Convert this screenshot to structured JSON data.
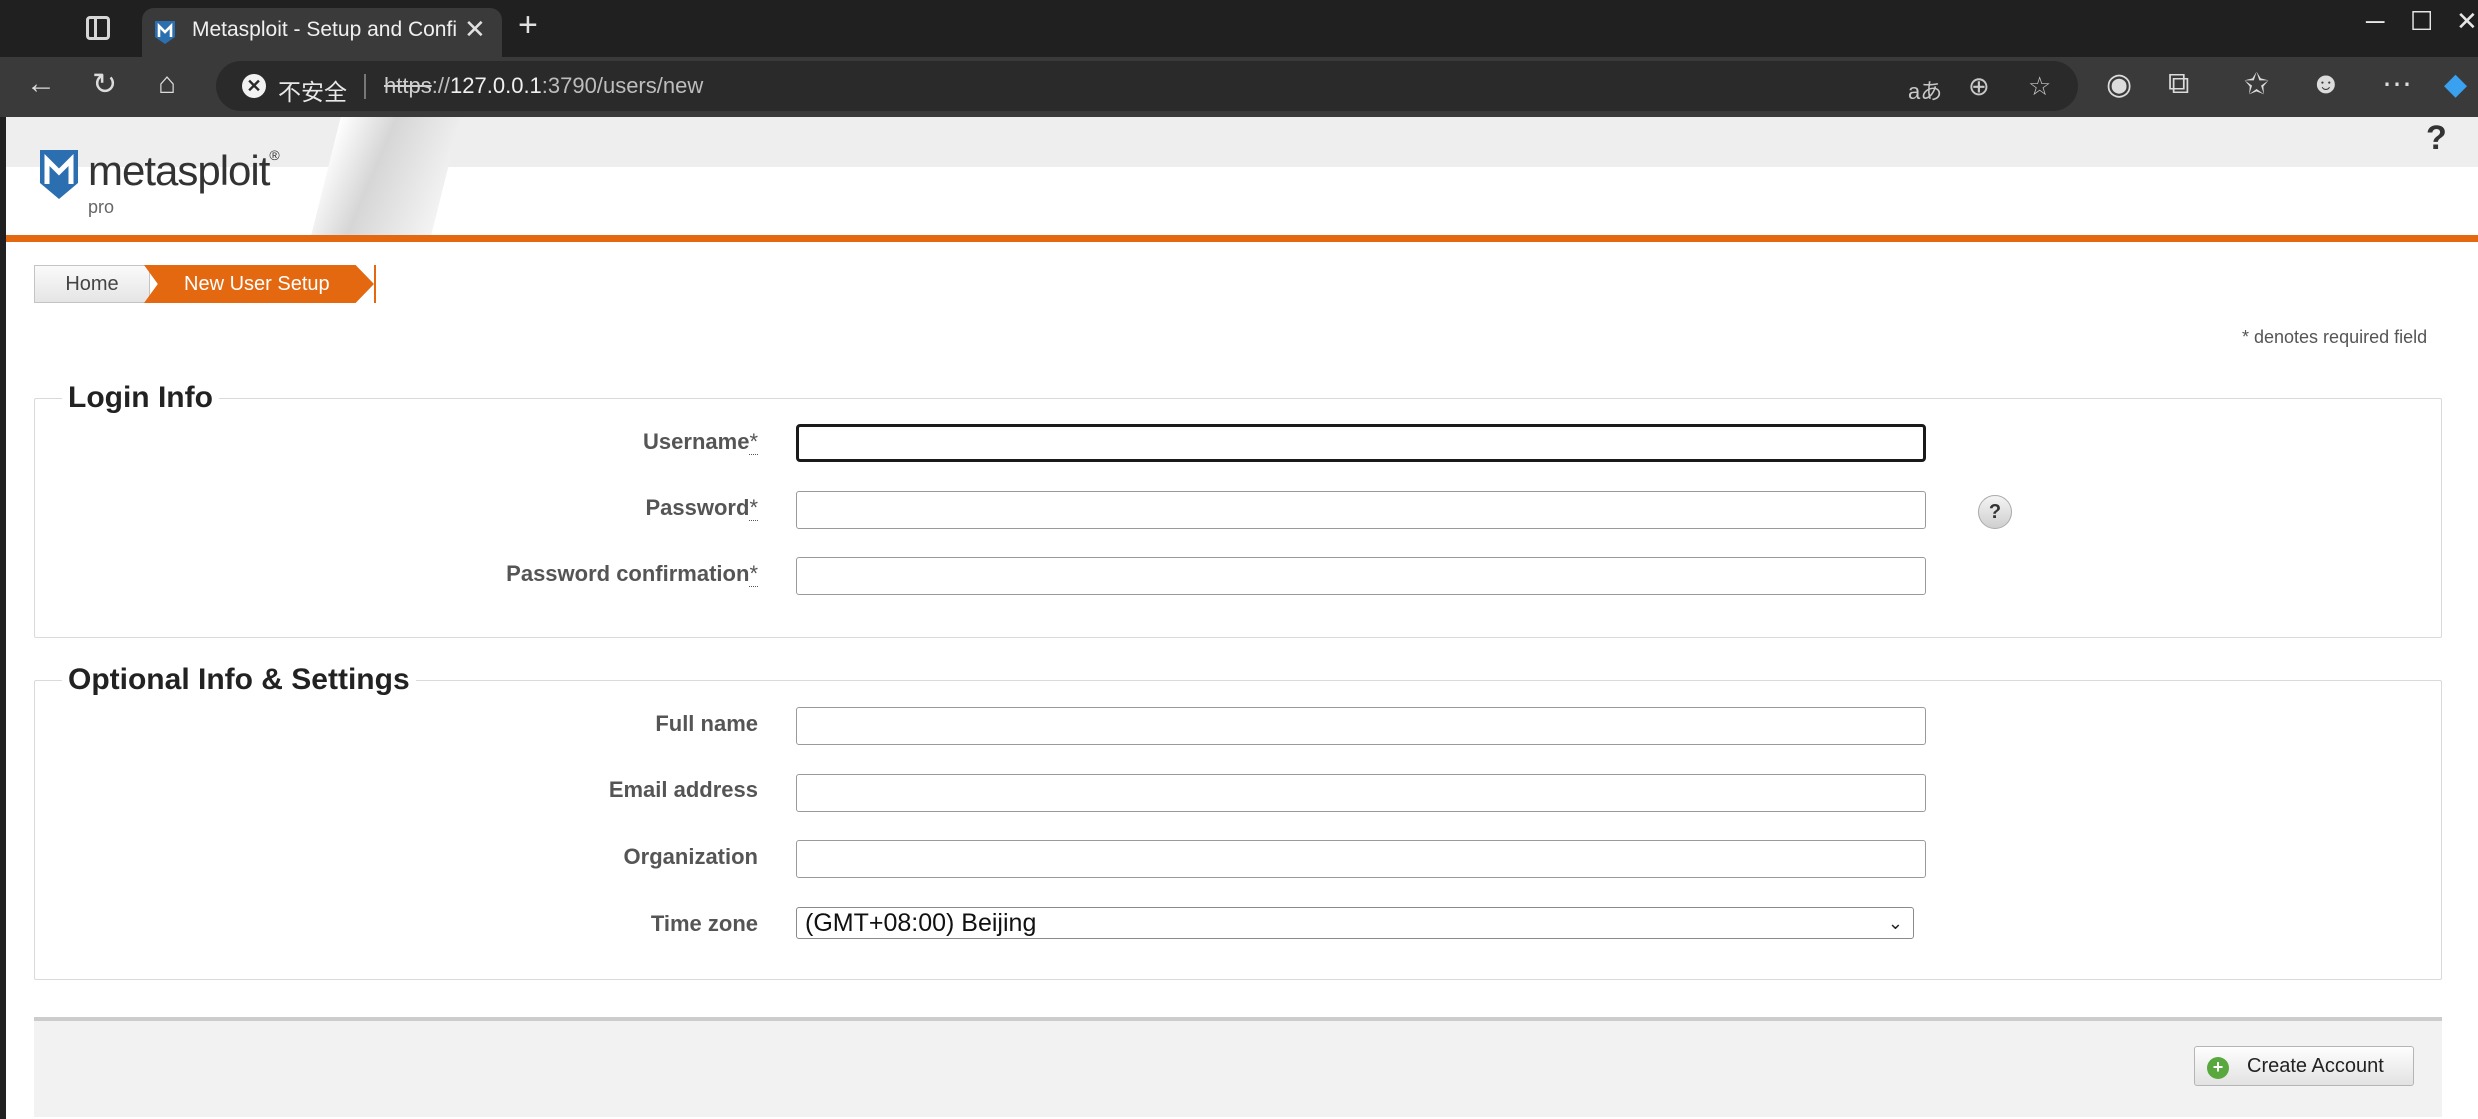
{
  "browser": {
    "tab_title": "Metasploit - Setup and Configuration",
    "new_tab_icon": "plus-icon",
    "security_label": "不安全",
    "url_scheme": "https",
    "url_host": "127.0.0.1",
    "url_rest": ":3790/users/new"
  },
  "header": {
    "logo_word": "metasploit",
    "logo_reg": "®",
    "logo_sub": "pro",
    "help_label": "?"
  },
  "breadcrumb": {
    "home": "Home",
    "current": "New User Setup"
  },
  "required_note": "* denotes required field",
  "login_info": {
    "legend": "Login Info",
    "username_label": "Username",
    "password_label": "Password",
    "password_confirmation_label": "Password confirmation",
    "required_mark": "*",
    "help_label": "?"
  },
  "optional_info": {
    "legend": "Optional Info & Settings",
    "full_name_label": "Full name",
    "email_label": "Email address",
    "organization_label": "Organization",
    "time_zone_label": "Time zone",
    "time_zone_value": "(GMT+08:00) Beijing"
  },
  "actions": {
    "create_account": "Create Account"
  },
  "colors": {
    "accent": "#e36810",
    "create_icon": "#58a83e"
  }
}
